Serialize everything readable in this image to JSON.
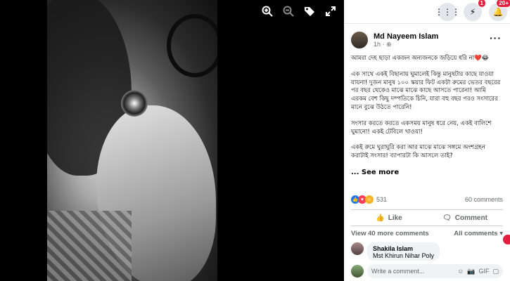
{
  "viewer": {
    "tools": [
      {
        "icon": "zoom-in-icon"
      },
      {
        "icon": "zoom-out-icon"
      },
      {
        "icon": "tag-icon"
      },
      {
        "icon": "fullscreen-icon"
      }
    ]
  },
  "topbar": {
    "messenger_badge": "1",
    "notifications_badge": "20+"
  },
  "post": {
    "author": "Md Nayeem Islam",
    "time": "1h · ",
    "privacy_icon": "globe-icon",
    "paragraphs": [
      "আমরা দেহ ছাড়া একজন অন্যজনকে জড়িয়ে ধরি না❤️😂",
      "এক সাথে একই বিছানায় ঘুমালেই কিন্তু মানুষটার কাছে যাওয়া যায়না! দুজন মানুষ ১০০ স্কয়ার ফিট একটা রুমের ভেতর বছরের পর বছর থেকেও মাঝে মাঝে কাছে আসতে পারেনা! আমি এরকম বেশ কিছু দম্পতিকে চিনি, যারা বহু বছর পরও সংসারের মানে বুঝে উঠতে পারেনি!",
      "সংসার করতে করতে একসময় মানুষ ধরে নেয়, একই বালিশে ঘুমানো! একই টেবিলে খাওয়া!",
      "একই রুমে ঘুরাঘুরি করা আর মাঝে মাঝে সঙ্গমে অংশগ্রহন করাটাই সংসার! ব্যাপারটা কি আসলে তাই?"
    ],
    "see_more": "... See more",
    "reaction_count": "531",
    "comment_count": "60 comments",
    "like_label": "Like",
    "comment_label": "Comment",
    "view_more": "View 40 more comments",
    "all_comments": "All comments ▾",
    "comment_author": "Shakila Islam",
    "comment_text": "Mst Khirun Nihar Poly",
    "write_placeholder": "Write a comment...",
    "write_icons": [
      "☺",
      "📷",
      "GIF",
      "▢"
    ]
  },
  "colors": {
    "badge": "#e41e3f",
    "like_blue": "#1877f2",
    "love_red": "#f33e58",
    "haha_yellow": "#f7b125"
  }
}
